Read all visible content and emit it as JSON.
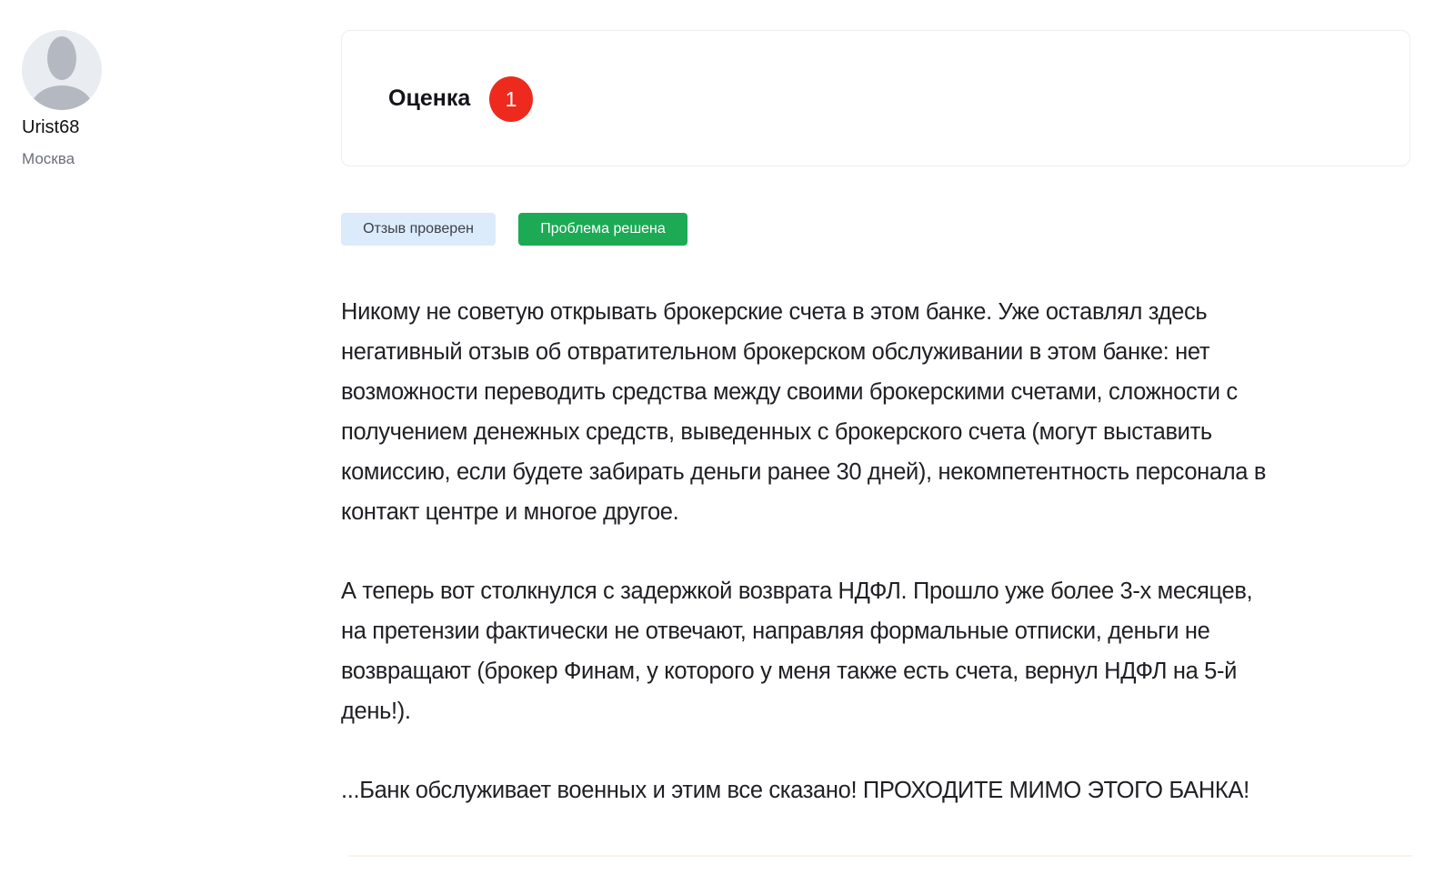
{
  "author": {
    "name": "Urist68",
    "city": "Москва",
    "avatar_icon": "user-placeholder-icon"
  },
  "rating": {
    "label": "Оценка",
    "value": "1",
    "color": "#ee2a1e"
  },
  "tags": [
    {
      "label": "Отзыв проверен",
      "color": "#dcebfb"
    },
    {
      "label": "Проблема решена",
      "color": "#1caa55"
    }
  ],
  "review": {
    "paragraphs": [
      {
        "lines": [
          "Никому не советую открывать брокерские счета в этом банке. Уже оставлял здесь",
          "негативный отзыв об отвратительном брокерском обслуживании в этом банке: нет",
          "возможности переводить средства между своими брокерскими счетами, сложности с",
          "получением денежных средств, выведенных с брокерского счета (могут выставить",
          "комиссию, если будете забирать деньги ранее 30 дней), некомпетентность персонала в",
          "контакт центре и многое другое."
        ]
      },
      {
        "lines": [
          "А теперь вот столкнулся с задержкой возврата НДФЛ. Прошло уже более 3-х месяцев,",
          "на претензии фактически не отвечают, направляя формальные отписки, деньги не",
          "возвращают (брокер Финам, у которого у меня также есть счета, вернул НДФЛ на 5-й",
          "день!)."
        ]
      },
      {
        "lines": [
          "...Банк обслуживает военных и этим все сказано! ПРОХОДИТЕ МИМО ЭТОГО БАНКА!"
        ]
      }
    ]
  }
}
